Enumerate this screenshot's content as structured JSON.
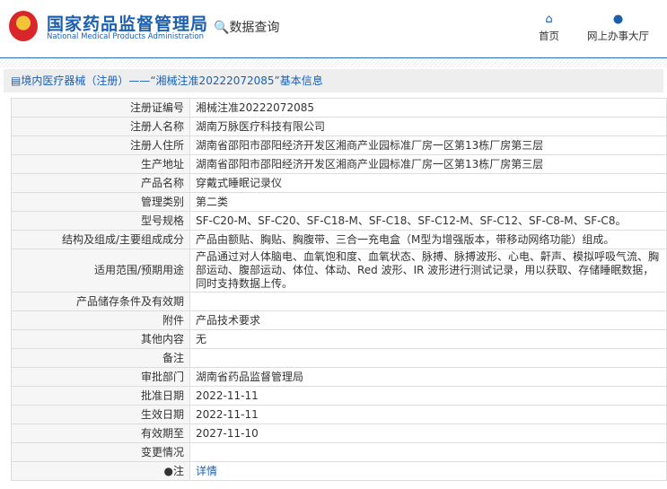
{
  "header": {
    "title_cn": "国家药品监督管理局",
    "title_en": "National Medical Products Administration",
    "query": "数据查询",
    "nav": [
      {
        "label": "首页",
        "icon": "home-icon"
      },
      {
        "label": "网上办事大厅",
        "icon": "user-icon"
      }
    ]
  },
  "breadcrumb": "境内医疗器械（注册）——“湘械注准20222072085”基本信息",
  "rows": [
    {
      "label": "注册证编号",
      "value": "湘械注准20222072085"
    },
    {
      "label": "注册人名称",
      "value": "湖南万脉医疗科技有限公司"
    },
    {
      "label": "注册人住所",
      "value": "湖南省邵阳市邵阳经济开发区湘商产业园标准厂房一区第13栋厂房第三层"
    },
    {
      "label": "生产地址",
      "value": "湖南省邵阳市邵阳经济开发区湘商产业园标准厂房一区第13栋厂房第三层"
    },
    {
      "label": "产品名称",
      "value": "穿戴式睡眠记录仪"
    },
    {
      "label": "管理类别",
      "value": "第二类"
    },
    {
      "label": "型号规格",
      "value": "SF-C20-M、SF-C20、SF-C18-M、SF-C18、SF-C12-M、SF-C12、SF-C8-M、SF-C8。"
    },
    {
      "label": "结构及组成/主要组成成分",
      "value": "产品由额贴、胸贴、胸腹带、三合一充电盒（M型为增强版本，带移动网络功能）组成。"
    },
    {
      "label": "适用范围/预期用途",
      "value": "产品通过对人体脑电、血氧饱和度、血氧状态、脉搏、脉搏波形、心电、鼾声、模拟呼吸气流、胸部运动、腹部运动、体位、体动、Red 波形、IR 波形进行测试记录，用以获取、存储睡眠数据，同时支持数据上传。"
    },
    {
      "label": "产品储存条件及有效期",
      "value": ""
    },
    {
      "label": "附件",
      "value": "产品技术要求"
    },
    {
      "label": "其他内容",
      "value": "无"
    },
    {
      "label": "备注",
      "value": ""
    },
    {
      "label": "审批部门",
      "value": "湖南省药品监督管理局"
    },
    {
      "label": "批准日期",
      "value": "2022-11-11"
    },
    {
      "label": "生效日期",
      "value": "2022-11-11"
    },
    {
      "label": "有效期至",
      "value": "2027-11-10"
    },
    {
      "label": "变更情况",
      "value": ""
    }
  ],
  "note": {
    "label": "注",
    "link": "详情"
  }
}
